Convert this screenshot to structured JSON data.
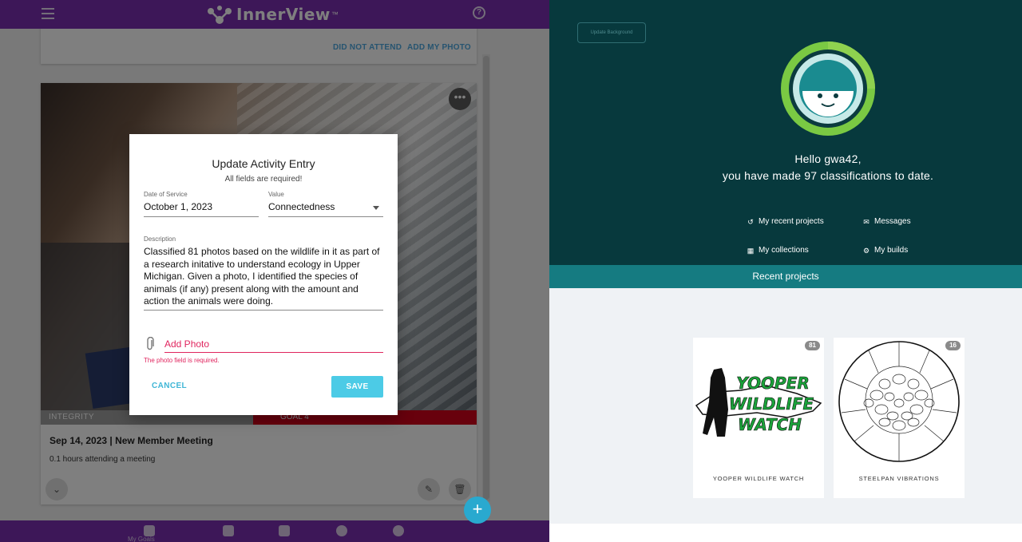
{
  "innerview": {
    "brand": "InnerView",
    "brand_tm": "™",
    "top_card": {
      "did_not_attend": "DID NOT ATTEND",
      "add_my_photo": "ADD MY PHOTO"
    },
    "entry": {
      "tag_left": "INTEGRITY",
      "tag_right": "GOAL 4",
      "title": "Sep 14, 2023 | New Member Meeting",
      "subtitle": "0.1 hours attending a meeting"
    },
    "bottom_nav": {
      "first_label": "My Goals"
    },
    "modal": {
      "title": "Update Activity Entry",
      "subtitle": "All fields are required!",
      "date_label": "Date of Service",
      "date_value": "October 1, 2023",
      "value_label": "Value",
      "value_value": "Connectedness",
      "desc_label": "Description",
      "desc_value": "Classified 81 photos based on the wildlife in it as part of a research initative to understand ecology in Upper Michigan. Given a photo, I identified the species of animals (if any) present along with the amount and action the animals were doing.",
      "photo_label": "Add Photo",
      "photo_error": "The photo field is required.",
      "cancel": "CANCEL",
      "save": "SAVE"
    }
  },
  "zooniverse": {
    "update_background": "Update Background",
    "hello": "Hello gwa42,",
    "classifications": "you have made 97 classifications to date.",
    "links": {
      "recent_projects": "My recent projects",
      "messages": "Messages",
      "collections": "My collections",
      "builds": "My builds"
    },
    "recent_header": "Recent projects",
    "projects": [
      {
        "name": "YOOPER WILDLIFE WATCH",
        "count": "81",
        "logo_lines": [
          "YOOPER",
          "WILDLIFE",
          "WATCH"
        ]
      },
      {
        "name": "STEELPAN VIBRATIONS",
        "count": "16"
      }
    ]
  },
  "colors": {
    "innerview_purple": "#7b2fb0",
    "zooniverse_teal": "#07393d",
    "recent_bar": "#157b81",
    "error_pink": "#e0245e",
    "save_cyan": "#4ccbe6"
  }
}
